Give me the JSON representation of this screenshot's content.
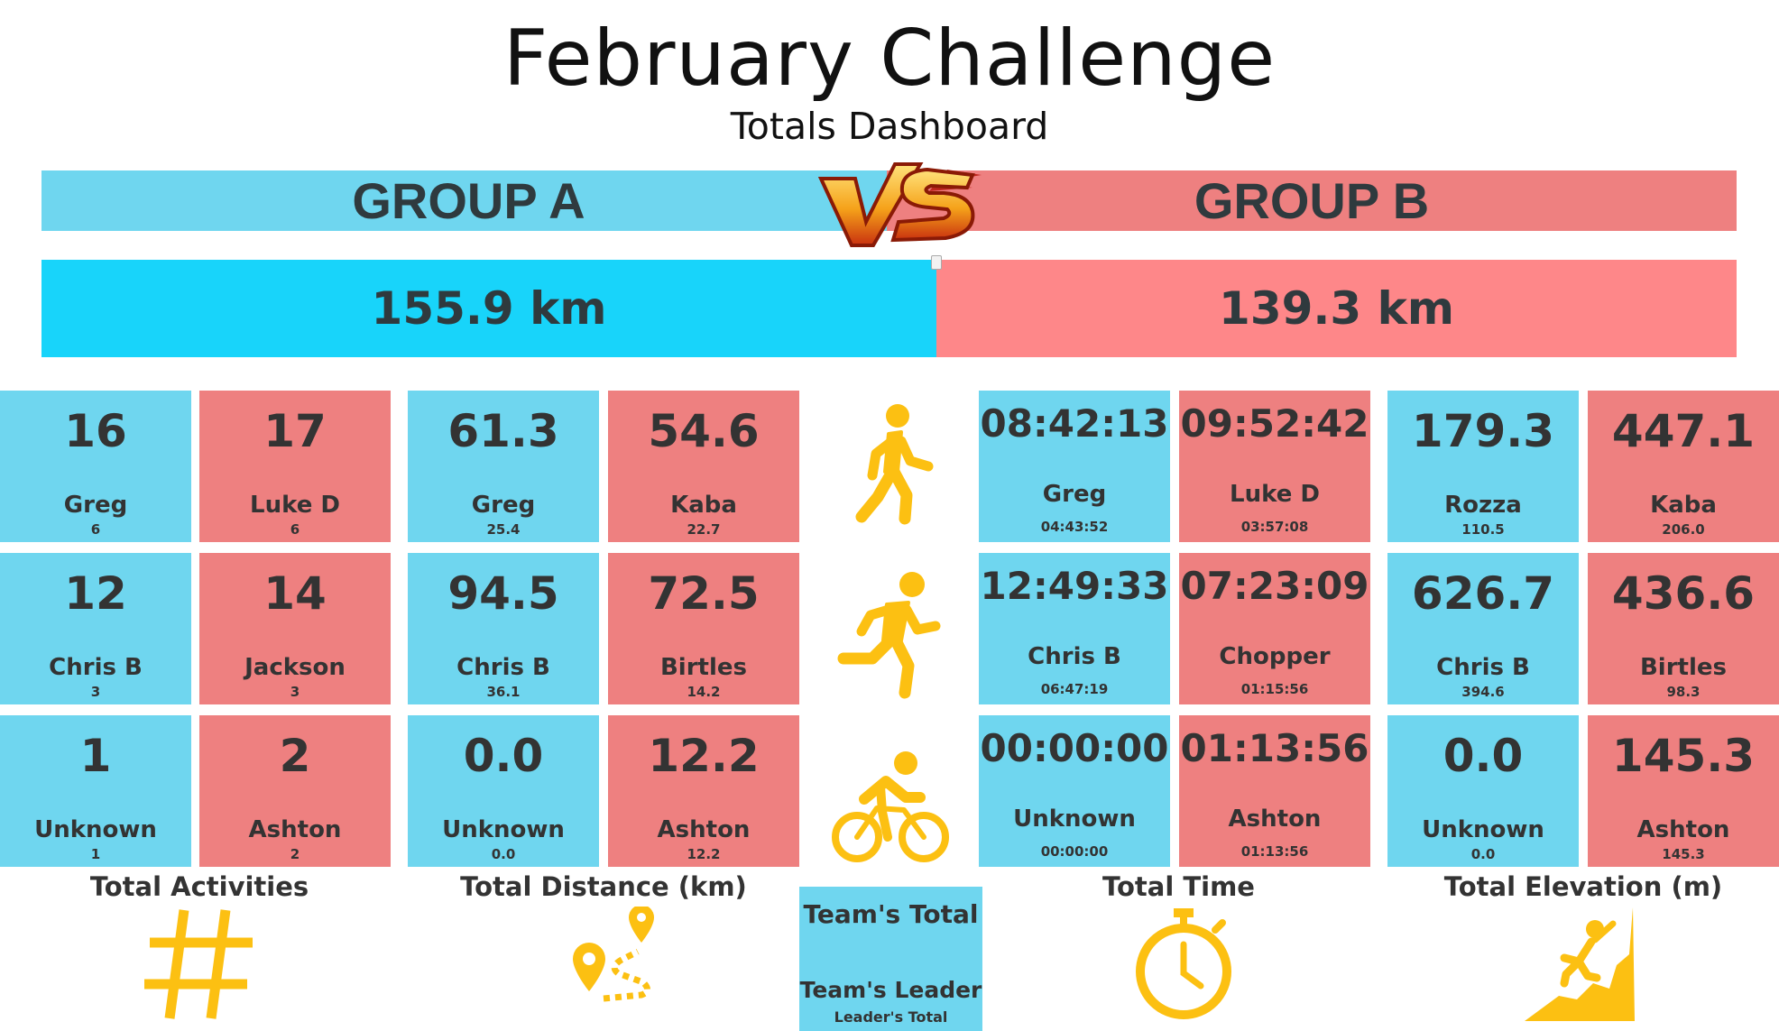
{
  "title": "February Challenge",
  "subtitle": "Totals Dashboard",
  "groups": {
    "a": "GROUP A",
    "b": "GROUP B"
  },
  "distance": {
    "a": "155.9 km",
    "b": "139.3 km",
    "a_share": 0.528
  },
  "colors": {
    "group_a": "#6fd6ef",
    "group_b": "#ee8080",
    "dist_a": "#18d4fa",
    "dist_b": "#fe8789",
    "icon": "#fcc012"
  },
  "activities": [
    "walk-icon",
    "run-icon",
    "bike-icon"
  ],
  "stats": {
    "walk": {
      "activities": {
        "a": {
          "value": "16",
          "name": "Greg",
          "sub": "6"
        },
        "b": {
          "value": "17",
          "name": "Luke D",
          "sub": "6"
        }
      },
      "distance": {
        "a": {
          "value": "61.3",
          "name": "Greg",
          "sub": "25.4"
        },
        "b": {
          "value": "54.6",
          "name": "Kaba",
          "sub": "22.7"
        }
      },
      "time": {
        "a": {
          "value": "08:42:13",
          "name": "Greg",
          "sub": "04:43:52"
        },
        "b": {
          "value": "09:52:42",
          "name": "Luke D",
          "sub": "03:57:08"
        }
      },
      "elevation": {
        "a": {
          "value": "179.3",
          "name": "Rozza",
          "sub": "110.5"
        },
        "b": {
          "value": "447.1",
          "name": "Kaba",
          "sub": "206.0"
        }
      }
    },
    "run": {
      "activities": {
        "a": {
          "value": "12",
          "name": "Chris B",
          "sub": "3"
        },
        "b": {
          "value": "14",
          "name": "Jackson",
          "sub": "3"
        }
      },
      "distance": {
        "a": {
          "value": "94.5",
          "name": "Chris B",
          "sub": "36.1"
        },
        "b": {
          "value": "72.5",
          "name": "Birtles",
          "sub": "14.2"
        }
      },
      "time": {
        "a": {
          "value": "12:49:33",
          "name": "Chris B",
          "sub": "06:47:19"
        },
        "b": {
          "value": "07:23:09",
          "name": "Chopper",
          "sub": "01:15:56"
        }
      },
      "elevation": {
        "a": {
          "value": "626.7",
          "name": "Chris B",
          "sub": "394.6"
        },
        "b": {
          "value": "436.6",
          "name": "Birtles",
          "sub": "98.3"
        }
      }
    },
    "bike": {
      "activities": {
        "a": {
          "value": "1",
          "name": "Unknown",
          "sub": "1"
        },
        "b": {
          "value": "2",
          "name": "Ashton",
          "sub": "2"
        }
      },
      "distance": {
        "a": {
          "value": "0.0",
          "name": "Unknown",
          "sub": "0.0"
        },
        "b": {
          "value": "12.2",
          "name": "Ashton",
          "sub": "12.2"
        }
      },
      "time": {
        "a": {
          "value": "00:00:00",
          "name": "Unknown",
          "sub": "00:00:00"
        },
        "b": {
          "value": "01:13:56",
          "name": "Ashton",
          "sub": "01:13:56"
        }
      },
      "elevation": {
        "a": {
          "value": "0.0",
          "name": "Unknown",
          "sub": "0.0"
        },
        "b": {
          "value": "145.3",
          "name": "Ashton",
          "sub": "145.3"
        }
      }
    }
  },
  "categories": {
    "activities": {
      "label": "Total Activities",
      "icon": "hash-icon"
    },
    "distance": {
      "label": "Total Distance (km)",
      "icon": "route-icon"
    },
    "time": {
      "label": "Total Time",
      "icon": "stopwatch-icon"
    },
    "elevation": {
      "label": "Total Elevation (m)",
      "icon": "climb-icon"
    }
  },
  "legend": {
    "title": "Team's Total",
    "leader": "Team's Leader",
    "leader_total": "Leader's Total"
  }
}
